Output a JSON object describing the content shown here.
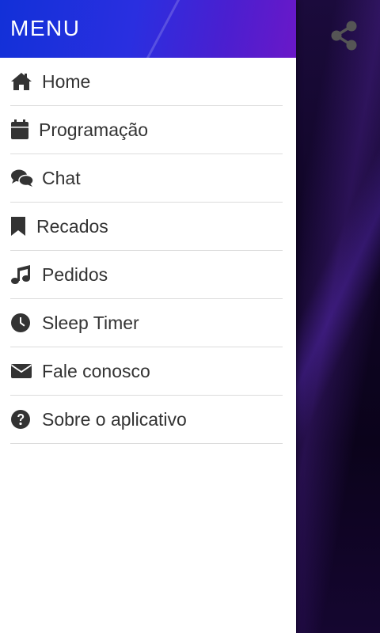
{
  "drawer": {
    "title": "MENU",
    "items": [
      {
        "label": "Home",
        "icon": "home-icon"
      },
      {
        "label": "Programação",
        "icon": "calendar-icon"
      },
      {
        "label": "Chat",
        "icon": "chat-bubbles-icon"
      },
      {
        "label": "Recados",
        "icon": "bookmark-icon"
      },
      {
        "label": "Pedidos",
        "icon": "music-note-icon"
      },
      {
        "label": "Sleep Timer",
        "icon": "clock-icon"
      },
      {
        "label": "Fale conosco",
        "icon": "envelope-icon"
      },
      {
        "label": "Sobre o aplicativo",
        "icon": "question-circle-icon"
      }
    ]
  },
  "toolbar": {
    "share_icon": "share-icon"
  },
  "colors": {
    "header_gradient_start": "#1230d8",
    "header_gradient_end": "#6a18c8",
    "text": "#333333",
    "icon": "#333333",
    "background": "#12052a"
  }
}
